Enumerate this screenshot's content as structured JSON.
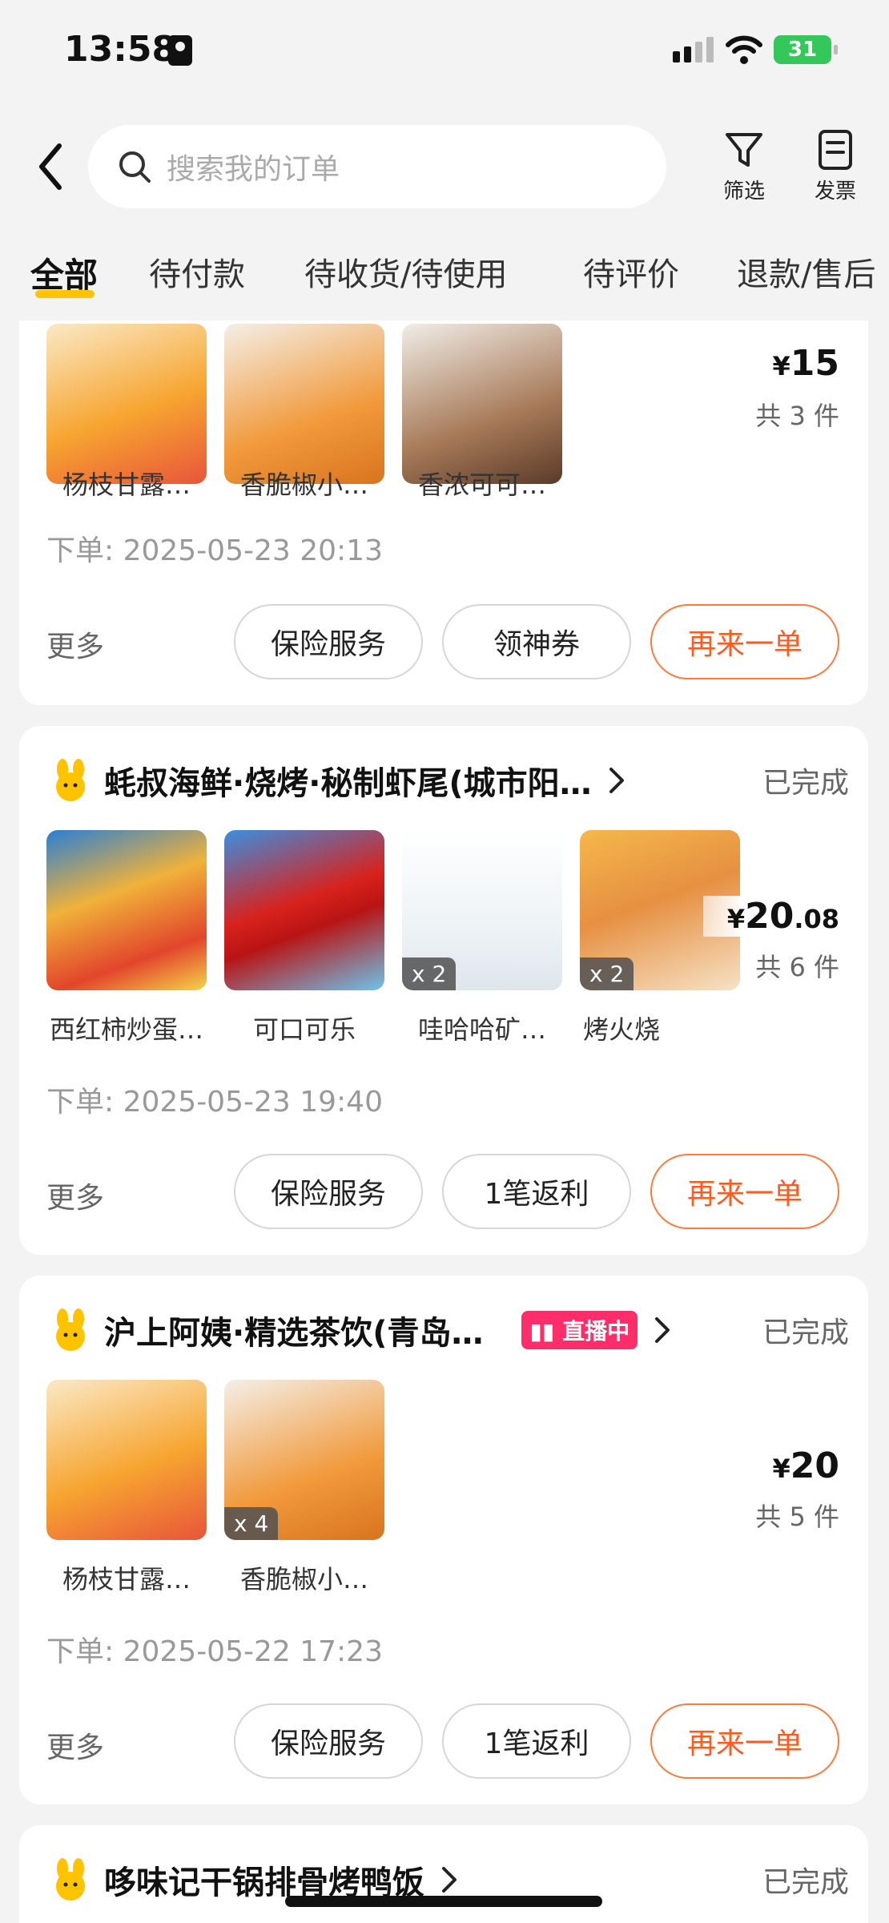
{
  "status_bar": {
    "time": "13:58",
    "battery": "31"
  },
  "header": {
    "search_placeholder": "搜索我的订单",
    "filter_label": "筛选",
    "invoice_label": "发票"
  },
  "tabs": [
    "全部",
    "待付款",
    "待收货/待使用",
    "待评价",
    "退款/售后"
  ],
  "orders": [
    {
      "items": [
        {
          "name": "杨枝甘露…",
          "qty": ""
        },
        {
          "name": "香脆椒小…",
          "qty": ""
        },
        {
          "name": "香浓可可…",
          "qty": ""
        }
      ],
      "price_yen": "¥",
      "price_int": "15",
      "price_dec": "",
      "count": "共 3 件",
      "order_time": "下单: 2025-05-23 20:13",
      "more": "更多",
      "buttons": [
        "保险服务",
        "领神券",
        "再来一单"
      ]
    },
    {
      "shop": "蚝叔海鲜·烧烤·秘制虾尾(城市阳…",
      "status": "已完成",
      "items": [
        {
          "name": "西红柿炒蛋…",
          "qty": ""
        },
        {
          "name": "可口可乐",
          "qty": ""
        },
        {
          "name": "哇哈哈矿…",
          "qty": "x 2"
        },
        {
          "name": "烤火烧",
          "qty": "x 2"
        }
      ],
      "price_yen": "¥",
      "price_int": "20",
      "price_dec": ".08",
      "count": "共 6 件",
      "order_time": "下单: 2025-05-23 19:40",
      "more": "更多",
      "buttons": [
        "保险服务",
        "1笔返利",
        "再来一单"
      ]
    },
    {
      "shop": "沪上阿姨·精选茶饮(青岛…",
      "live": "直播中",
      "status": "已完成",
      "items": [
        {
          "name": "杨枝甘露…",
          "qty": ""
        },
        {
          "name": "香脆椒小…",
          "qty": "x 4"
        }
      ],
      "price_yen": "¥",
      "price_int": "20",
      "price_dec": "",
      "count": "共 5 件",
      "order_time": "下单: 2025-05-22 17:23",
      "more": "更多",
      "buttons": [
        "保险服务",
        "1笔返利",
        "再来一单"
      ]
    },
    {
      "shop": "哆味记干锅排骨烤鸭饭",
      "status": "已完成"
    }
  ],
  "colors": {
    "accent": "#ffc300",
    "orange": "#ff5a1f",
    "live": "#ff2d6a"
  }
}
